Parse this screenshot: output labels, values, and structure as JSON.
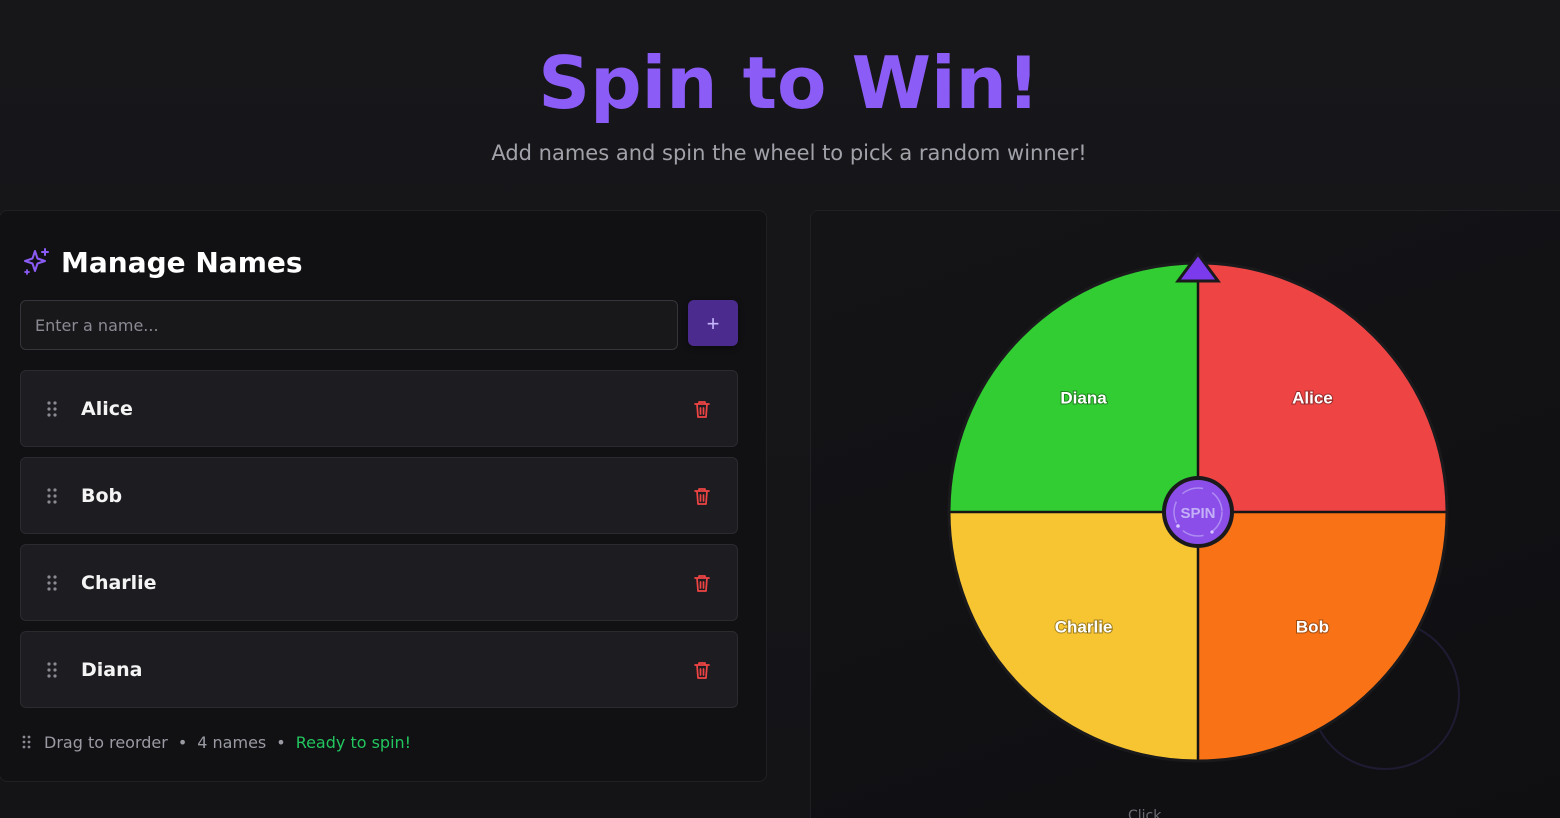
{
  "header": {
    "title": "Spin to Win!",
    "subtitle": "Add names and spin the wheel to pick a random winner!"
  },
  "manage": {
    "title": "Manage Names",
    "input_placeholder": "Enter a name...",
    "input_value": "",
    "add_button_label": "+",
    "names": [
      {
        "label": "Alice"
      },
      {
        "label": "Bob"
      },
      {
        "label": "Charlie"
      },
      {
        "label": "Diana"
      }
    ],
    "footer": {
      "drag_hint": "Drag to reorder",
      "count": "4 names",
      "status": "Ready to spin!"
    }
  },
  "wheel": {
    "spin_label": "SPIN",
    "segments": [
      {
        "label": "Alice",
        "color": "#ef4444"
      },
      {
        "label": "Bob",
        "color": "#f97316"
      },
      {
        "label": "Charlie",
        "color": "#f8c532"
      },
      {
        "label": "Diana",
        "color": "#32cd32"
      }
    ],
    "pointer_color": "#7c3aed",
    "hint": "Click"
  },
  "colors": {
    "accent": "#8b5cf6",
    "danger": "#ef4444",
    "success": "#22c55e"
  },
  "icons": {
    "heading": "sparkles-icon",
    "drag": "grip-vertical-icon",
    "delete": "trash-icon",
    "add": "plus-icon"
  }
}
